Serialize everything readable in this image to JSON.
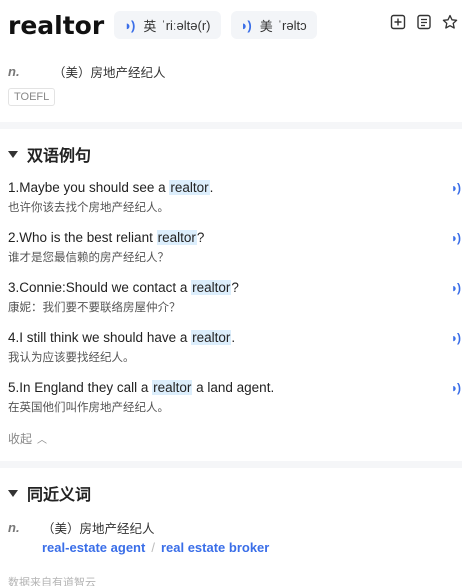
{
  "word": "realtor",
  "pronunciations": [
    {
      "lang": "英",
      "ipa": "ˈriːəltə(r)"
    },
    {
      "lang": "美",
      "ipa": "ˈrəltɔ"
    }
  ],
  "tools": [
    "add-to-wordbook-icon",
    "note-icon",
    "star-icon"
  ],
  "definition": {
    "pos": "n.",
    "text": "（美）房地产经纪人"
  },
  "tag": "TOEFL",
  "bilingual": {
    "title": "双语例句",
    "examples": [
      {
        "pre": "1.Maybe you should see a ",
        "hl": "realtor",
        "post": ".",
        "zh": "也许你该去找个房地产经纪人。"
      },
      {
        "pre": "2.Who is the best reliant ",
        "hl": "realtor",
        "post": "?",
        "zh": "谁才是您最信赖的房产经纪人？"
      },
      {
        "pre": "3.Connie:Should we contact a ",
        "hl": "realtor",
        "post": "?",
        "zh": "康妮：我们要不要联络房屋仲介？"
      },
      {
        "pre": "4.I still think we should have a ",
        "hl": "realtor",
        "post": ".",
        "zh": "我认为应该要找经纪人。"
      },
      {
        "pre": "5.In England they call a ",
        "hl": "realtor",
        "post": " a land agent.",
        "zh": "在英国他们叫作房地产经纪人。"
      }
    ],
    "collapse_label": "收起"
  },
  "synonyms": {
    "title": "同近义词",
    "pos": "n.",
    "meaning": "（美）房地产经纪人",
    "words": [
      "real-estate agent",
      "real estate broker"
    ]
  },
  "source": "数据来自有道智云"
}
